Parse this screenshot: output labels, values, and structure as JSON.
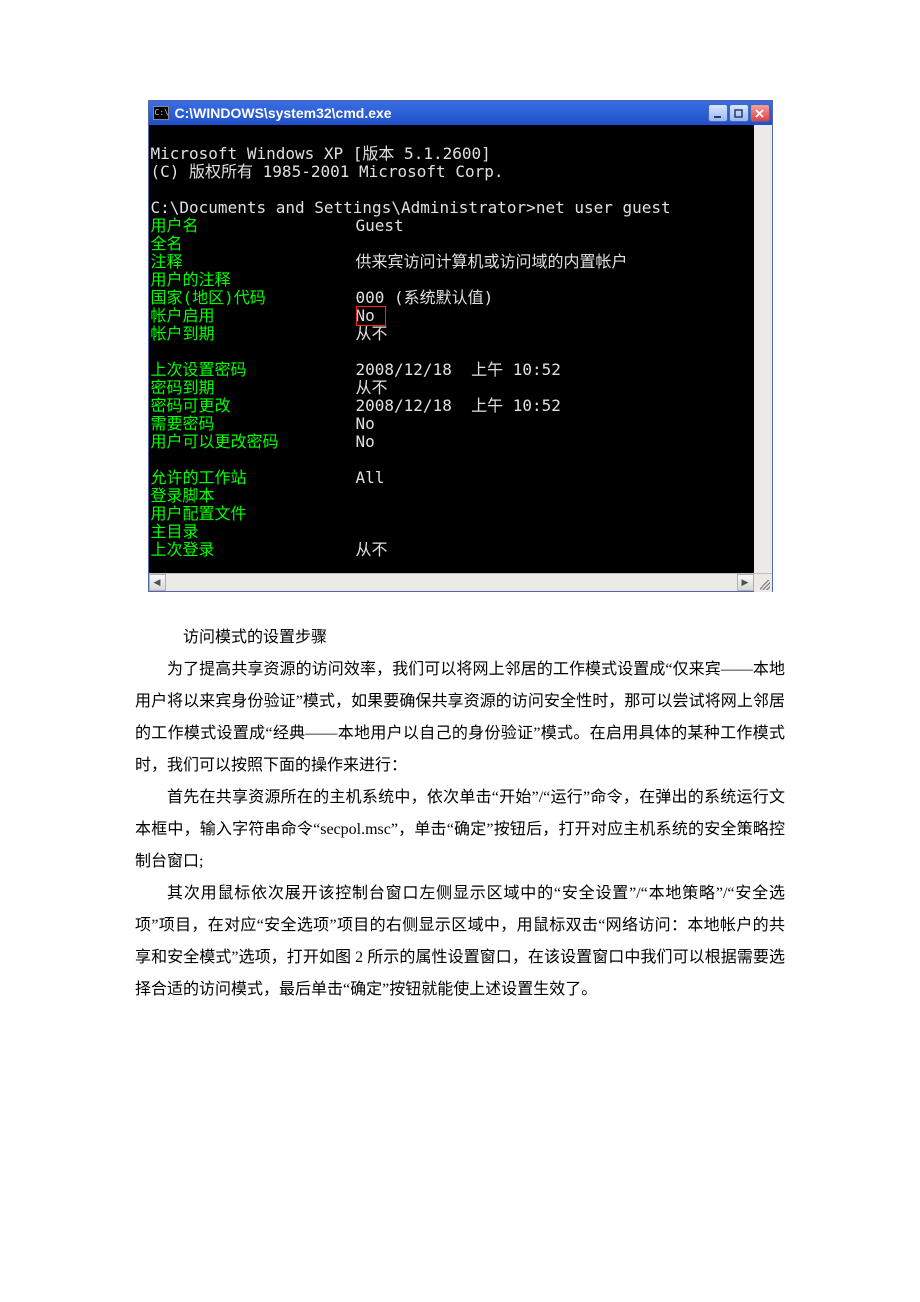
{
  "cmd": {
    "title": "C:\\WINDOWS\\system32\\cmd.exe",
    "icon_label": "C:\\",
    "header": "Microsoft Windows XP [版本 5.1.2600]\n(C) 版权所有 1985-2001 Microsoft Corp.",
    "prompt_line": "C:\\Documents and Settings\\Administrator>net user guest",
    "rows": [
      {
        "label": "用户名",
        "value": "Guest"
      },
      {
        "label": "全名",
        "value": ""
      },
      {
        "label": "注释",
        "value": "供来宾访问计算机或访问域的内置帐户"
      },
      {
        "label": "用户的注释",
        "value": ""
      },
      {
        "label": "国家(地区)代码",
        "value": "000 (系统默认值)"
      },
      {
        "label": "帐户启用",
        "value": "No"
      },
      {
        "label": "帐户到期",
        "value": "从不"
      }
    ],
    "rows2": [
      {
        "label": "上次设置密码",
        "value": "2008/12/18  上午 10:52"
      },
      {
        "label": "密码到期",
        "value": "从不"
      },
      {
        "label": "密码可更改",
        "value": "2008/12/18  上午 10:52"
      },
      {
        "label": "需要密码",
        "value": "No"
      },
      {
        "label": "用户可以更改密码",
        "value": "No"
      }
    ],
    "rows3": [
      {
        "label": "允许的工作站",
        "value": "All"
      },
      {
        "label": "登录脚本",
        "value": ""
      },
      {
        "label": "用户配置文件",
        "value": ""
      },
      {
        "label": "主目录",
        "value": ""
      },
      {
        "label": "上次登录",
        "value": "从不"
      }
    ]
  },
  "article": {
    "title": "访问模式的设置步骤",
    "p1": "为了提高共享资源的访问效率，我们可以将网上邻居的工作模式设置成“仅来宾——本地用户将以来宾身份验证”模式，如果要确保共享资源的访问安全性时，那可以尝试将网上邻居的工作模式设置成“经典——本地用户以自己的身份验证”模式。在启用具体的某种工作模式时，我们可以按照下面的操作来进行：",
    "p2": "首先在共享资源所在的主机系统中，依次单击“开始”/“运行”命令，在弹出的系统运行文本框中，输入字符串命令“secpol.msc”，单击“确定”按钮后，打开对应主机系统的安全策略控制台窗口;",
    "p3": "其次用鼠标依次展开该控制台窗口左侧显示区域中的“安全设置”/“本地策略”/“安全选项”项目，在对应“安全选项”项目的右侧显示区域中，用鼠标双击“网络访问：本地帐户的共享和安全模式”选项，打开如图 2 所示的属性设置窗口，在该设置窗口中我们可以根据需要选择合适的访问模式，最后单击“确定”按钮就能使上述设置生效了。"
  }
}
